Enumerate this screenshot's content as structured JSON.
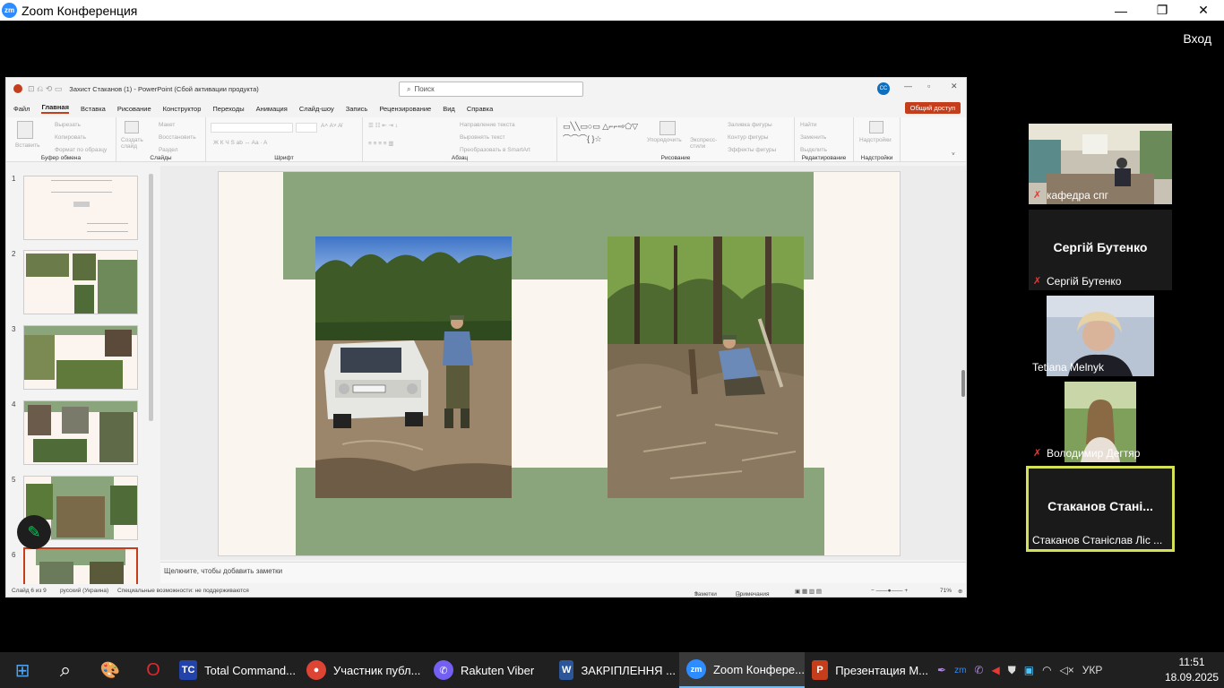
{
  "zoom": {
    "logo": "zm",
    "title": "Zoom Конференция",
    "login": "Вход",
    "controls": {
      "minimize": "—",
      "restore": "❐",
      "close": "✕"
    }
  },
  "ppt": {
    "quick_access": "⊡ ⎌ ⟲ ▭",
    "doc_title": "Захист Стаканов (1) - PowerPoint (Сбой активации продукта)",
    "search_placeholder": "Поиск",
    "avatar_initials": "СС",
    "tabs": [
      "Файл",
      "Главная",
      "Вставка",
      "Рисование",
      "Конструктор",
      "Переходы",
      "Анимация",
      "Слайд-шоу",
      "Запись",
      "Рецензирование",
      "Вид",
      "Справка"
    ],
    "share": "Общий доступ",
    "ribbon": {
      "paste": "Вставить",
      "cut": "Вырезать",
      "copy": "Копировать",
      "format_painter": "Формат по образцу",
      "clipboard_group": "Буфер обмена",
      "new_slide": "Создать слайд",
      "layout": "Макет",
      "reset": "Восстановить",
      "section": "Раздел",
      "slides_group": "Слайды",
      "font_group": "Шрифт",
      "text_direction": "Направление текста",
      "align_text": "Выровнять текст",
      "smartart": "Преобразовать в SmartArt",
      "paragraph_group": "Абзац",
      "arrange": "Упорядочить",
      "quick_styles": "Экспресс-стили",
      "shape_fill": "Заливка фигуры",
      "shape_outline": "Контур фигуры",
      "shape_effects": "Эффекты фигуры",
      "drawing_group": "Рисование",
      "find": "Найти",
      "replace": "Заменить",
      "select": "Выделить",
      "editing_group": "Редактирование",
      "addins": "Надстройки",
      "addins_group": "Надстройки"
    },
    "slide_numbers": [
      "1",
      "2",
      "3",
      "4",
      "5",
      "6"
    ],
    "notes_placeholder": "Щелкните, чтобы добавить заметки",
    "status": {
      "slide": "Слайд 6 из 9",
      "language": "русский (Украина)",
      "accessibility": "Специальные возможности: не поддерживаются",
      "notes": "Заметки",
      "comments": "Примечания",
      "zoom": "71%"
    }
  },
  "participants": [
    {
      "name": "кафедра спг",
      "muted": true,
      "video": true
    },
    {
      "name": "Сергій Бутенко",
      "display": "Сергій Бутенко",
      "muted": true,
      "video": false
    },
    {
      "name": "Tetiana Melnyk",
      "muted": false,
      "video": true
    },
    {
      "name": "Володимир Дегтяр",
      "muted": true,
      "video": true
    },
    {
      "name": "Стаканов Станіслав Ліс ...",
      "display": "Стаканов  Стані...",
      "muted": false,
      "video": false,
      "active_speaker": true
    }
  ],
  "taskbar": {
    "apps": [
      {
        "label": "Total Command...",
        "icon": "TC"
      },
      {
        "label": "Участник публ...",
        "icon": "●"
      },
      {
        "label": "Rakuten Viber",
        "icon": "✆"
      },
      {
        "label": "ЗАКРІПЛЕННЯ ...",
        "icon": "W"
      },
      {
        "label": "Zoom Конфере...",
        "icon": "zm"
      },
      {
        "label": "Презентация М...",
        "icon": "P"
      }
    ],
    "language": "УКР",
    "time": "11:51",
    "date": "18.09.2025"
  },
  "colors": {
    "accent": "#c43e1c",
    "slide_green": "#8aa57c",
    "zoom_blue": "#2d8cff",
    "speaker_border": "#d4e157"
  }
}
